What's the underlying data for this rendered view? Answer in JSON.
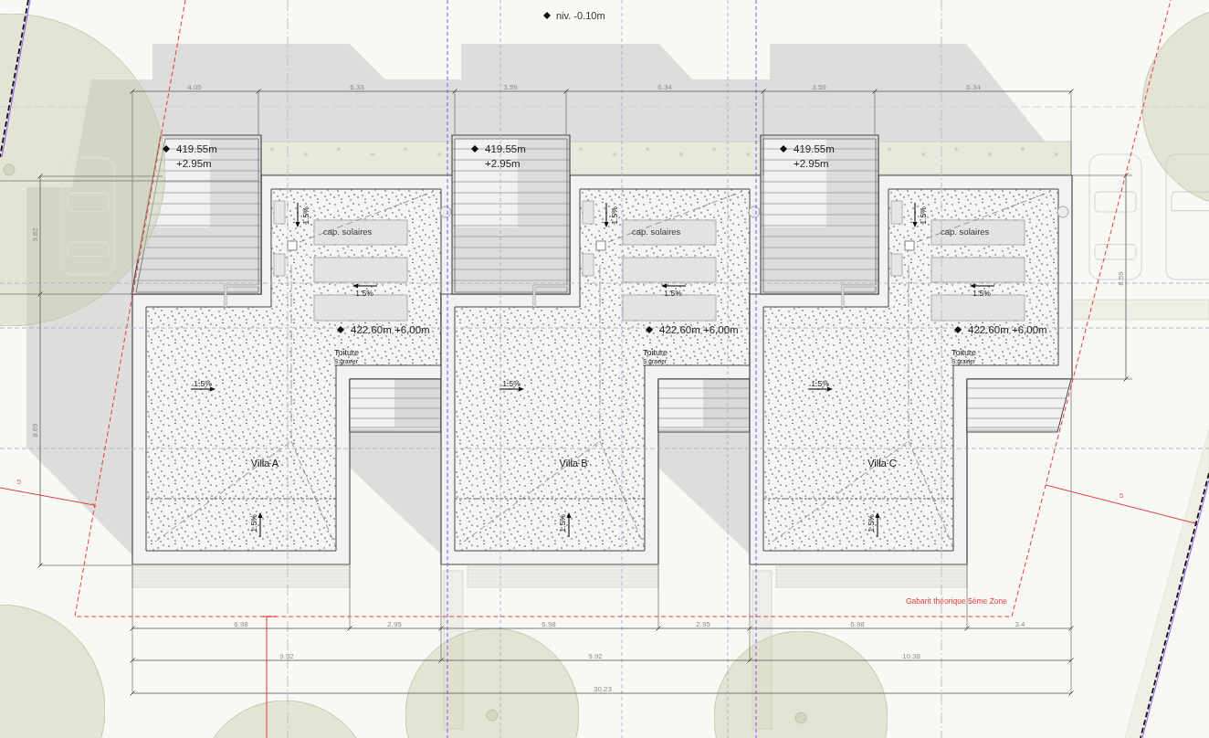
{
  "elevation_marker": {
    "label": "niv. -0.10m"
  },
  "top_dimensions": [
    "4.05",
    "6.33",
    "3.59",
    "6.34",
    "3.59",
    "6.34"
  ],
  "side_dimensions": [
    "3.82",
    "8.69",
    "6.59"
  ],
  "villas": [
    {
      "name": "Villa A",
      "stair_elevation": "419.55m",
      "stair_height": "+2.95m",
      "panel_label": "cap. solaires",
      "roof_elevation": "422.60m +6,00m",
      "roof_label": "Toiture",
      "roof_finish": "S:gravier",
      "slopes": [
        {
          "label": "1.5%",
          "kind": "down"
        },
        {
          "label": "1.5%",
          "kind": "left"
        },
        {
          "label": "1.5%",
          "kind": "right"
        },
        {
          "label": "1.5%",
          "kind": "up"
        }
      ]
    },
    {
      "name": "Villa B",
      "stair_elevation": "419.55m",
      "stair_height": "+2.95m",
      "panel_label": "cap. solaires",
      "roof_elevation": "422.60m +6,00m",
      "roof_label": "Toiture",
      "roof_finish": "S:gravier",
      "slopes": [
        {
          "label": "1.5%",
          "kind": "down"
        },
        {
          "label": "1.5%",
          "kind": "left"
        },
        {
          "label": "1.5%",
          "kind": "right"
        },
        {
          "label": "1.5%",
          "kind": "up"
        }
      ]
    },
    {
      "name": "Villa C",
      "stair_elevation": "419.55m",
      "stair_height": "+2.95m",
      "panel_label": "cap. solaires",
      "roof_elevation": "422.60m +6,00m",
      "roof_label": "Toiture",
      "roof_finish": "S:gravier",
      "slopes": [
        {
          "label": "1.5%",
          "kind": "down"
        },
        {
          "label": "1.5%",
          "kind": "left"
        },
        {
          "label": "1.5%",
          "kind": "right"
        },
        {
          "label": "1.5%",
          "kind": "up"
        }
      ]
    }
  ],
  "setback": {
    "label": "Gabarit théorique 5ème Zone",
    "distances": [
      "5",
      "5"
    ]
  },
  "bottom_dimensions": {
    "parts": [
      "6.98",
      "2.95",
      "6.98",
      "2.95",
      "6.98",
      "3.4"
    ],
    "villas": [
      "9.92",
      "9.92",
      "10.38"
    ],
    "total": "30.23"
  }
}
